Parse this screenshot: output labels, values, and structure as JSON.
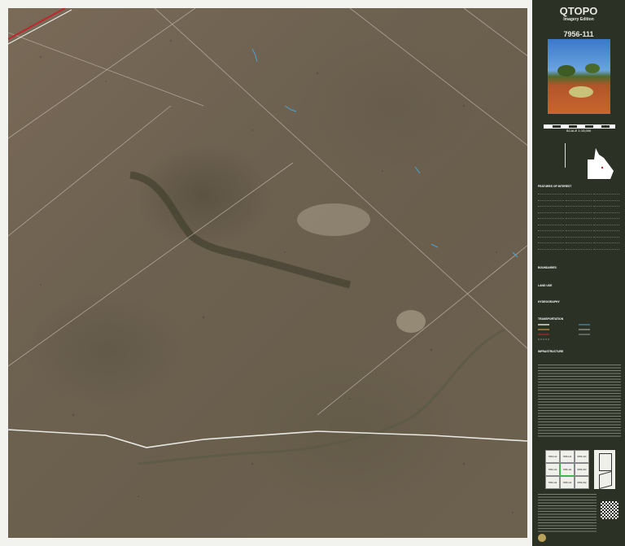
{
  "panel": {
    "title": "QTOPO",
    "subtitle": "Imagery Edition",
    "map_id": "7956-111",
    "scale": "SCALE 1:15,000",
    "legend_heading": "FEATURES OF INTEREST",
    "sections": [
      "BOUNDARIES",
      "LAND USE",
      "HYDROGRAPHY",
      "TRANSPORTATION",
      "INFRASTRUCTURE"
    ],
    "index_sheets": [
      "7956-122",
      "7956-121",
      "8056-444",
      "7956-113",
      "7956-111",
      "8056-333",
      "7956-114",
      "7956-112",
      "8056-332"
    ]
  },
  "colors": {
    "panel_bg": "#2c3126",
    "road": "#e9e9e4",
    "creek": "#4aa3d6",
    "rail": "#c0262c",
    "index_highlight": "#39b54a"
  }
}
